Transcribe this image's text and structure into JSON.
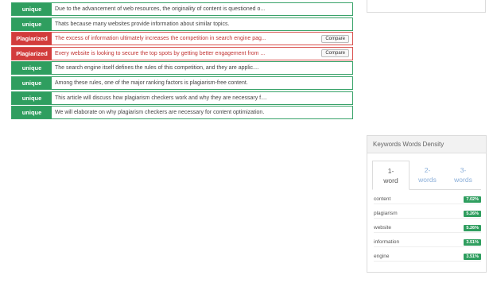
{
  "results": [
    {
      "status": "unique",
      "type": "unique",
      "text": "Due to the advancement of web resources, the originality of content is questioned o...",
      "compare": ""
    },
    {
      "status": "unique",
      "type": "unique",
      "text": "Thats because many websites provide information about similar topics.",
      "compare": ""
    },
    {
      "status": "Plagiarized",
      "type": "plag",
      "text": "The excess of information ultimately increases the competition in search engine pag...",
      "compare": "Compare"
    },
    {
      "status": "Plagiarized",
      "type": "plag",
      "text": "Every website is looking to secure the top spots by getting better engagement from ...",
      "compare": "Compare"
    },
    {
      "status": "unique",
      "type": "unique",
      "text": "The search engine itself defines the rules of this competition, and they are applic....",
      "compare": ""
    },
    {
      "status": "unique",
      "type": "unique",
      "text": "Among these rules, one of the major ranking factors is plagiarism-free content.",
      "compare": ""
    },
    {
      "status": "unique",
      "type": "unique",
      "text": "This article will discuss how plagiarism checkers work and why they are necessary f....",
      "compare": ""
    },
    {
      "status": "unique",
      "type": "unique",
      "text": "We will elaborate on why plagiarism checkers are necessary for content optimization.",
      "compare": ""
    }
  ],
  "density": {
    "title": "Keywords Words Density",
    "tabs": [
      {
        "line1": "1-",
        "line2": "word"
      },
      {
        "line1": "2-",
        "line2": "words"
      },
      {
        "line1": "3-",
        "line2": "words"
      }
    ],
    "keywords": [
      {
        "word": "content",
        "pct": "7.02%"
      },
      {
        "word": "plagiarism",
        "pct": "5.26%"
      },
      {
        "word": "website",
        "pct": "5.26%"
      },
      {
        "word": "information",
        "pct": "3.51%"
      },
      {
        "word": "engine",
        "pct": "3.51%"
      }
    ]
  },
  "colors": {
    "unique": "#2f9e5f",
    "plagiarized": "#d23c3c",
    "tab_link": "#8aaed9"
  }
}
